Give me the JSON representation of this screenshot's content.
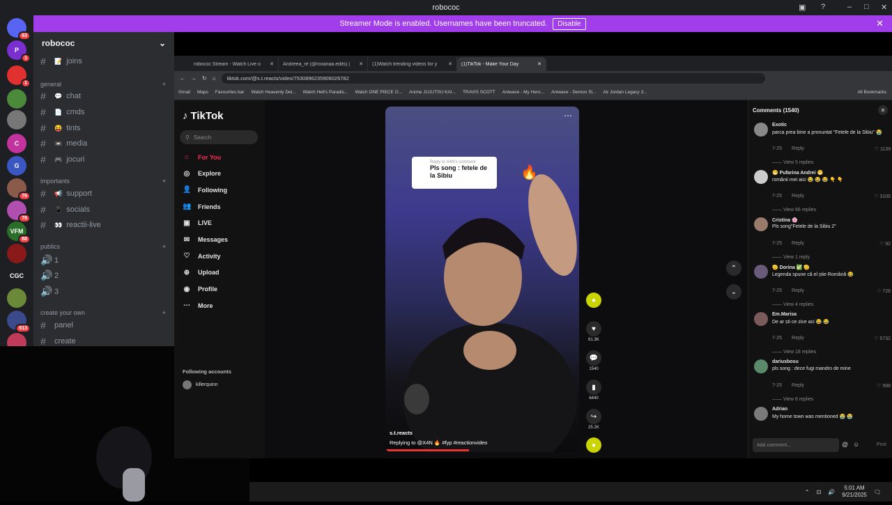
{
  "window": {
    "title": "robococ"
  },
  "banner": {
    "text": "Streamer Mode is enabled. Usernames have been truncated.",
    "button": "Disable"
  },
  "servers": [
    {
      "label": "",
      "badge": "63",
      "color": "#5865f2"
    },
    {
      "label": "P",
      "badge": "1",
      "color": "#7a2fd0"
    },
    {
      "label": "",
      "badge": "1",
      "color": "#e03030"
    },
    {
      "label": "",
      "badge": "",
      "color": "#4a8a3a"
    },
    {
      "label": "",
      "badge": "",
      "color": "#777"
    },
    {
      "label": "C",
      "badge": "",
      "color": "#c2339e"
    },
    {
      "label": "G",
      "badge": "",
      "color": "#3b57c4"
    },
    {
      "label": "",
      "badge": "76",
      "color": "#8a5a4a"
    },
    {
      "label": "",
      "badge": "78",
      "color": "#b04fb0"
    },
    {
      "label": "VFM",
      "badge": "68",
      "color": "#2a6e2a"
    },
    {
      "label": "",
      "badge": "",
      "color": "#8a1a1a"
    },
    {
      "label": "CGC",
      "badge": "",
      "color": "#1e1f22"
    },
    {
      "label": "",
      "badge": "",
      "color": "#6a8a3a"
    },
    {
      "label": "",
      "badge": "613",
      "color": "#3a4a8a"
    },
    {
      "label": "",
      "badge": "",
      "color": "#c03a5a"
    }
  ],
  "sidebar": {
    "server_name": "robococ",
    "channels": [
      {
        "label": "joins",
        "emoji": "📝"
      },
      {
        "label": "chat",
        "emoji": "💬"
      },
      {
        "label": "cmds",
        "emoji": "📄"
      },
      {
        "label": "tints",
        "emoji": "😝"
      },
      {
        "label": "media",
        "emoji": "📼"
      },
      {
        "label": "jocuri",
        "emoji": "🎮"
      },
      {
        "label": "support",
        "emoji": "📢"
      },
      {
        "label": "socials",
        "emoji": "📱"
      },
      {
        "label": "reactii-live",
        "emoji": "👀"
      },
      {
        "label": "1",
        "emoji": ""
      },
      {
        "label": "2",
        "emoji": ""
      },
      {
        "label": "3",
        "emoji": ""
      },
      {
        "label": "panel",
        "emoji": ""
      },
      {
        "label": "create",
        "emoji": ""
      }
    ],
    "categories": [
      "general",
      "importants",
      "publics",
      "create your own"
    ]
  },
  "browser": {
    "tabs": [
      {
        "label": "robococ Stream - Watch Live o"
      },
      {
        "label": "Andreea_re (@roxanaa.edits) |"
      },
      {
        "label": "(1)Watch trending videos for y"
      },
      {
        "label": "(1)TikTok - Make Your Day"
      }
    ],
    "url": "tiktok.com/@s.t.reacts/video/7530896235906026782",
    "bookmarks": [
      "Gmail",
      "Maps",
      "Favourites bar",
      "Watch Heavenly Del...",
      "Watch Hell's Paradis...",
      "Watch ONE PIECE O...",
      "Anime JUJUTSU KAI...",
      "TRAVIS SCOTT",
      "Aniwave - My Hero...",
      "Aniwave - Demon Sl...",
      "Air Jordan Legacy 3...",
      "All Bookmarks"
    ]
  },
  "tiktok": {
    "logo": "TikTok",
    "search_placeholder": "Search",
    "nav": [
      {
        "label": "For You",
        "icon": "home-icon"
      },
      {
        "label": "Explore",
        "icon": "compass-icon"
      },
      {
        "label": "Following",
        "icon": "following-icon"
      },
      {
        "label": "Friends",
        "icon": "friends-icon"
      },
      {
        "label": "LIVE",
        "icon": "live-icon"
      },
      {
        "label": "Messages",
        "icon": "messages-icon"
      },
      {
        "label": "Activity",
        "icon": "activity-icon"
      },
      {
        "label": "Upload",
        "icon": "upload-icon"
      },
      {
        "label": "Profile",
        "icon": "profile-icon"
      },
      {
        "label": "More",
        "icon": "more-icon"
      }
    ],
    "following_title": "Following accounts",
    "following_account": "killerquinn",
    "video": {
      "reply_header": "Reply to X4N's comment",
      "reply_text": "Pls song : fetele de la Sibiu",
      "author": "s.t.reacts",
      "caption": "Replying to @X4N 🔥 #fyp #reactionvideo"
    },
    "actions": {
      "likes": "61.3K",
      "comments": "1540",
      "saves": "6440",
      "shares": "25.2K"
    },
    "comments_title": "Comments (1540)",
    "comments": [
      {
        "user": "Exotic",
        "text": "parca prea bine a pronuntat \"Fetele de la Sibiu\" 😭",
        "date": "7-25",
        "reply": "Reply",
        "likes": "1139",
        "more": "View 5 replies"
      },
      {
        "user": "😁 Pufarina Andrei 😁",
        "text": "românii mei aici 😂 😂 😂 👇 👇",
        "date": "7-25",
        "reply": "Reply",
        "likes": "3106",
        "more": "View 66 replies"
      },
      {
        "user": "Cristina 🌸",
        "text": "Pls song\"Fetele de la Sibiu 2\"",
        "date": "7-25",
        "reply": "Reply",
        "likes": "92",
        "more": "View 1 reply"
      },
      {
        "user": "🫡 Dorina ✅ 🫡",
        "text": "Legenda spune că el știe Română 😂",
        "date": "7-25",
        "reply": "Reply",
        "likes": "726",
        "more": "View 4 replies"
      },
      {
        "user": "Em.Marisa",
        "text": "De ar ști ce zice aci 😂 😂",
        "date": "7-25",
        "reply": "Reply",
        "likes": "5732",
        "more": "View 18 replies"
      },
      {
        "user": "dariusbosu",
        "text": "pls song : dece fugi mandro de mine",
        "date": "7-25",
        "reply": "Reply",
        "likes": "998",
        "more": "View 8 replies"
      },
      {
        "user": "Adrian",
        "text": "My home town was mentioned 😭 😭",
        "date": "",
        "reply": "",
        "likes": "",
        "more": ""
      }
    ],
    "add_comment_placeholder": "Add comment...",
    "post": "Post"
  },
  "taskbar": {
    "time": "5:01 AM",
    "date": "9/21/2025"
  }
}
